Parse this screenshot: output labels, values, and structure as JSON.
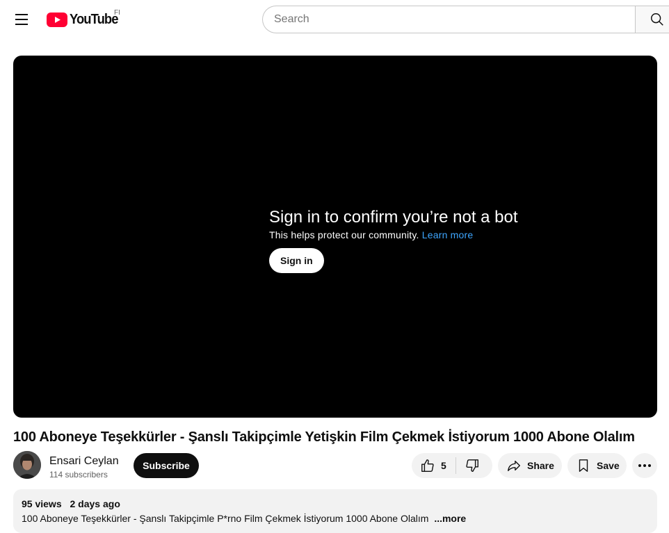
{
  "header": {
    "logo_text": "YouTube",
    "country_code": "FI",
    "search_placeholder": "Search"
  },
  "player": {
    "message_title": "Sign in to confirm you’re not a bot",
    "message_subtitle": "This helps protect our community.",
    "learn_more": "Learn more",
    "sign_in": "Sign in"
  },
  "video": {
    "title": "100 Aboneye Teşekkürler - Şanslı Takipçimle Yetişkin Film Çekmek İstiyorum 1000 Abone Olalım"
  },
  "channel": {
    "name": "Ensari Ceylan",
    "subscribers": "114 subscribers",
    "subscribe_label": "Subscribe"
  },
  "actions": {
    "like_count": "5",
    "share_label": "Share",
    "save_label": "Save"
  },
  "description": {
    "views": "95 views",
    "date": "2 days ago",
    "text": "100 Aboneye Teşekkürler - Şanslı Takipçimle P*rno Film Çekmek İstiyorum 1000 Abone Olalım",
    "more": "...more"
  },
  "colors": {
    "brand_red": "#ff0033",
    "link_blue": "#3ea6ff",
    "chip_bg": "#f2f2f2"
  }
}
